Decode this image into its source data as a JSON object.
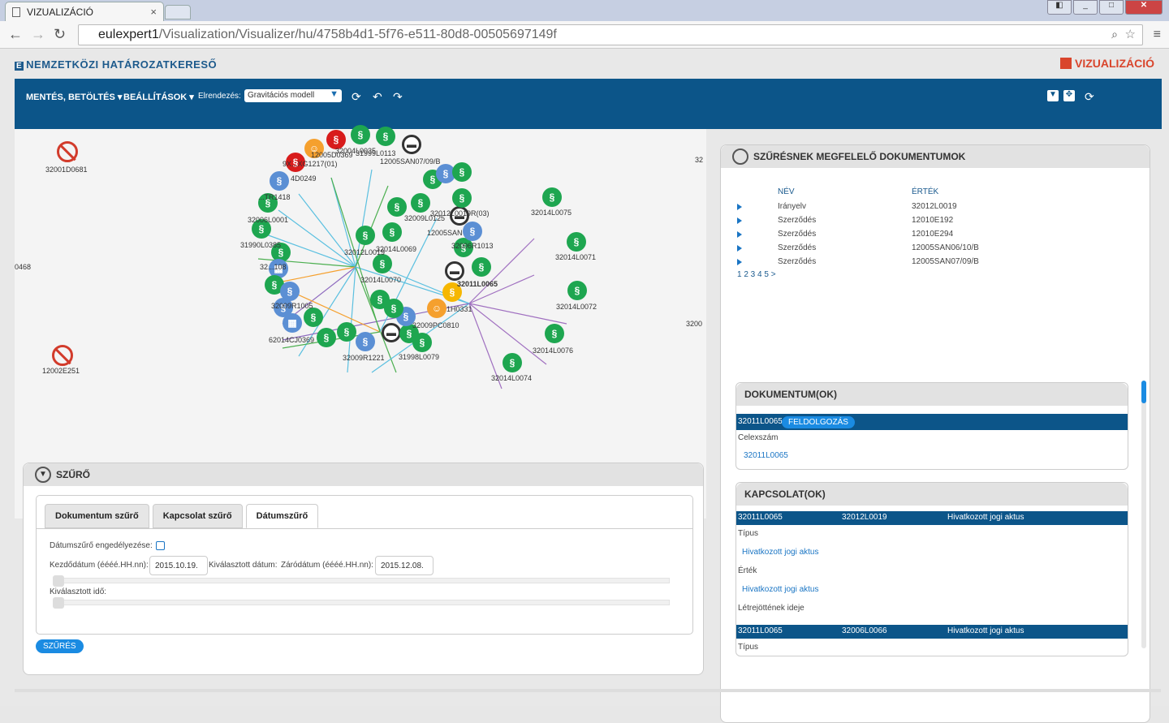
{
  "browser": {
    "tab_title": "VIZUALIZÁCIÓ",
    "tab_close": "×",
    "url_host": "eulexpert1",
    "url_path": "/Visualization/Visualizer/hu/4758b4d1-5f76-e511-80d8-00505697149f"
  },
  "app": {
    "brand": "NEMZETKÖZI HATÁROZATKERESŐ",
    "brand_mark": "E",
    "section": "VIZUALIZÁCIÓ"
  },
  "toolbar": {
    "save_load": "MENTÉS, BETÖLTÉS",
    "settings": "BEÁLLÍTÁSOK",
    "layout_label": "Elrendezés:",
    "layout_value": "Gravitációs modell"
  },
  "graph": {
    "left_labels": [
      "32001D0681",
      "12002E251",
      "0468"
    ],
    "right_edge_labels": [
      "32",
      "3200"
    ],
    "node_labels": [
      "32004L0035",
      "12005D0369",
      "31999L0113",
      "12005SAN07/09/B",
      "9X...XG1217(01)",
      "4D0249",
      "...TR1418",
      "32006L0001",
      "31990L0385",
      "32...108",
      "32012L0019",
      "32014L0069",
      "32014L0070",
      "32009L0125",
      "32011L0065",
      "32014L0075",
      "32014L0071",
      "32014L0072",
      "32014L0076",
      "32014L0074",
      "32009PC0810",
      "1H0331",
      "32009R1221",
      "31998L0079",
      "62014CJ0369",
      "32009R1005",
      "12005SAN",
      "32006R1013",
      "32012L0019R(03)"
    ]
  },
  "filter": {
    "title": "SZŰRŐ",
    "tabs": [
      "Dokumentum szűrő",
      "Kapcsolat szűrő",
      "Dátumszűrő"
    ],
    "enable_label": "Dátumszűrő engedélyezése:",
    "start_label": "Kezdődátum (éééé.HH.nn):",
    "start_value": "2015.10.19.",
    "selected_date_label": "Kiválasztott dátum:",
    "end_label": "Záródátum (éééé.HH.nn):",
    "end_value": "2015.12.08.",
    "selected_time_label": "Kiválasztott idő:",
    "button": "SZŰRÉS"
  },
  "results": {
    "title": "SZŰRÉSNEK MEGFELELŐ DOKUMENTUMOK",
    "col_name": "NÉV",
    "col_value": "ÉRTÉK",
    "rows": [
      {
        "name": "Irányelv",
        "value": "32012L0019"
      },
      {
        "name": "Szerződés",
        "value": "12010E192"
      },
      {
        "name": "Szerződés",
        "value": "12010E294"
      },
      {
        "name": "Szerződés",
        "value": "12005SAN06/10/B"
      },
      {
        "name": "Szerződés",
        "value": "12005SAN07/09/B"
      }
    ],
    "pager": "1 2 3 4 5 >"
  },
  "documents": {
    "title": "DOKUMENTUM(OK)",
    "id": "32011L0065",
    "badge": "FELDOLGOZÁS",
    "celex_label": "Celexszám",
    "celex_value": "32011L0065"
  },
  "relations": {
    "title": "KAPCSOLAT(OK)",
    "rows": [
      {
        "from": "32011L0065",
        "to": "32012L0019",
        "type": "Hivatkozott jogi aktus"
      },
      {
        "from": "32011L0065",
        "to": "32006L0066",
        "type": "Hivatkozott jogi aktus"
      }
    ],
    "type_label": "Típus",
    "type_value": "Hivatkozott jogi aktus",
    "value_label": "Érték",
    "value_value": "Hivatkozott jogi aktus",
    "created_label": "Létrejöttének ideje"
  },
  "colors": {
    "primary": "#0c5589",
    "accent": "#1a8be2",
    "danger": "#d81c1c",
    "node_green": "#1ea650",
    "node_blue": "#5b8fd4"
  }
}
